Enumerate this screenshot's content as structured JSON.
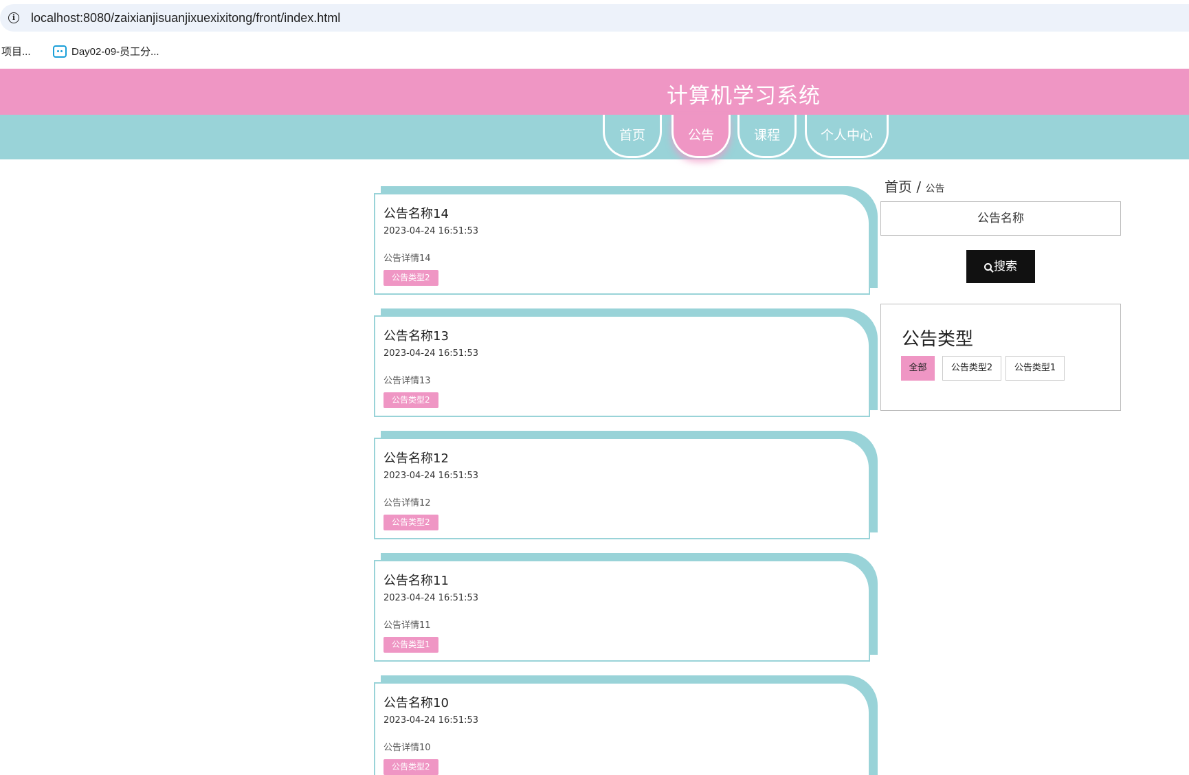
{
  "browser": {
    "url": "localhost:8080/zaixianjisuanjixuexixitong/front/index.html",
    "bookmarks": [
      "项目...",
      "Day02-09-员工分..."
    ]
  },
  "header": {
    "title": "计算机学习系统"
  },
  "nav": {
    "items": [
      "首页",
      "公告",
      "课程",
      "个人中心"
    ],
    "active": "公告"
  },
  "breadcrumb": {
    "home": "首页",
    "separator": "/",
    "current": "公告"
  },
  "search": {
    "placeholder": "公告名称",
    "button_label": "搜索"
  },
  "filter": {
    "title": "公告类型",
    "options": [
      "全部",
      "公告类型2",
      "公告类型1"
    ],
    "active": "全部"
  },
  "notices": [
    {
      "title": "公告名称14",
      "time": "2023-04-24 16:51:53",
      "detail": "公告详情14",
      "type": "公告类型2"
    },
    {
      "title": "公告名称13",
      "time": "2023-04-24 16:51:53",
      "detail": "公告详情13",
      "type": "公告类型2"
    },
    {
      "title": "公告名称12",
      "time": "2023-04-24 16:51:53",
      "detail": "公告详情12",
      "type": "公告类型2"
    },
    {
      "title": "公告名称11",
      "time": "2023-04-24 16:51:53",
      "detail": "公告详情11",
      "type": "公告类型1"
    },
    {
      "title": "公告名称10",
      "time": "2023-04-24 16:51:53",
      "detail": "公告详情10",
      "type": "公告类型2"
    }
  ],
  "colors": {
    "pink": "#ef96c4",
    "teal": "#99d3d8",
    "dark": "#111111"
  }
}
